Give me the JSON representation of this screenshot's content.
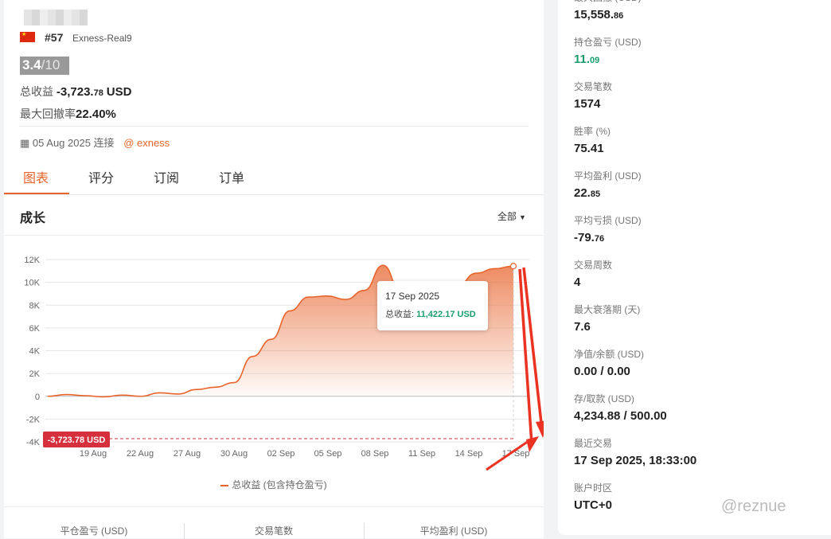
{
  "profile": {
    "rank": "#57",
    "account": "Exness-Real9",
    "score": "3.4",
    "score_max": "/10",
    "total_profit_label": "总收益",
    "total_profit_main": "-3,723.",
    "total_profit_dec": "78",
    "total_profit_unit": "USD",
    "max_drawdown_label": "最大回撤率",
    "max_drawdown_value": "22.40%",
    "connect_date": "05 Aug 2025 连接",
    "broker": "@ exness",
    "colors": {
      "accent": "#e8642c",
      "green": "#1a9e6b",
      "red": "#d62f3e"
    }
  },
  "tabs": [
    {
      "label": "图表"
    },
    {
      "label": "评分"
    },
    {
      "label": "订阅"
    },
    {
      "label": "订单"
    }
  ],
  "chart_section": {
    "title": "成长",
    "range": "全部",
    "tooltip_date": "17 Sep 2025",
    "tooltip_label": "总收益:",
    "tooltip_value": "11,422.17 USD",
    "current_marker": "-3,723.78 USD",
    "legend": "总收益 (包含持仓盈亏)"
  },
  "chart_data": {
    "type": "area",
    "title": "",
    "xlabel": "",
    "ylabel": "",
    "ylim": [
      -4000,
      12000
    ],
    "y_ticks": [
      "12K",
      "10K",
      "8K",
      "6K",
      "4K",
      "2K",
      "0",
      "-2K",
      "-4K"
    ],
    "x_ticks": [
      "19 Aug",
      "22 Aug",
      "27 Aug",
      "30 Aug",
      "02 Sep",
      "05 Sep",
      "08 Sep",
      "11 Sep",
      "14 Sep",
      "17 Sep"
    ],
    "series": [
      {
        "values": [
          [
            0,
            0
          ],
          [
            0.5,
            150
          ],
          [
            1.0,
            50
          ],
          [
            1.5,
            -50
          ],
          [
            2.0,
            100
          ],
          [
            2.5,
            0
          ],
          [
            3.0,
            300
          ],
          [
            3.5,
            200
          ],
          [
            4.0,
            600
          ],
          [
            4.5,
            800
          ],
          [
            5.0,
            1200
          ],
          [
            5.5,
            3500
          ],
          [
            6.0,
            5000
          ],
          [
            6.5,
            7500
          ],
          [
            7.0,
            8700
          ],
          [
            7.5,
            8800
          ],
          [
            8.0,
            8500
          ],
          [
            8.5,
            9300
          ],
          [
            9.0,
            11500
          ],
          [
            9.5,
            9000
          ],
          [
            10.0,
            7800
          ],
          [
            10.5,
            8000
          ],
          [
            11.0,
            9700
          ],
          [
            11.5,
            10800
          ],
          [
            12.0,
            11200
          ],
          [
            12.5,
            11422
          ]
        ]
      }
    ],
    "grid": true,
    "legend_position": "bottom"
  },
  "bottom_stats": [
    "平仓盈亏 (USD)",
    "交易笔数",
    "平均盈利 (USD)"
  ],
  "stats": [
    {
      "label": "最大回撤 (USD)",
      "main": "15,558.",
      "dec": "86"
    },
    {
      "label": "持仓盈亏 (USD)",
      "main": "11.",
      "dec": "09",
      "green": true
    },
    {
      "label": "交易笔数",
      "main": "1574",
      "dec": ""
    },
    {
      "label": "胜率 (%)",
      "main": "75.41",
      "dec": ""
    },
    {
      "label": "平均盈利 (USD)",
      "main": "22.",
      "dec": "85"
    },
    {
      "label": "平均亏损 (USD)",
      "main": "-79.",
      "dec": "76"
    },
    {
      "label": "交易周数",
      "main": "4",
      "dec": ""
    },
    {
      "label": "最大衰落期 (天)",
      "main": "7.6",
      "dec": ""
    },
    {
      "label": "净值/余额 (USD)",
      "main": "0.00 / 0.00",
      "dec": ""
    },
    {
      "label": "存/取款 (USD)",
      "main": "4,234.88 / 500.00",
      "dec": ""
    },
    {
      "label": "最近交易",
      "main": "17 Sep 2025, 18:33:00",
      "dec": ""
    },
    {
      "label": "账户时区",
      "main": "UTC+0",
      "dec": ""
    }
  ],
  "watermark": "@reznue"
}
